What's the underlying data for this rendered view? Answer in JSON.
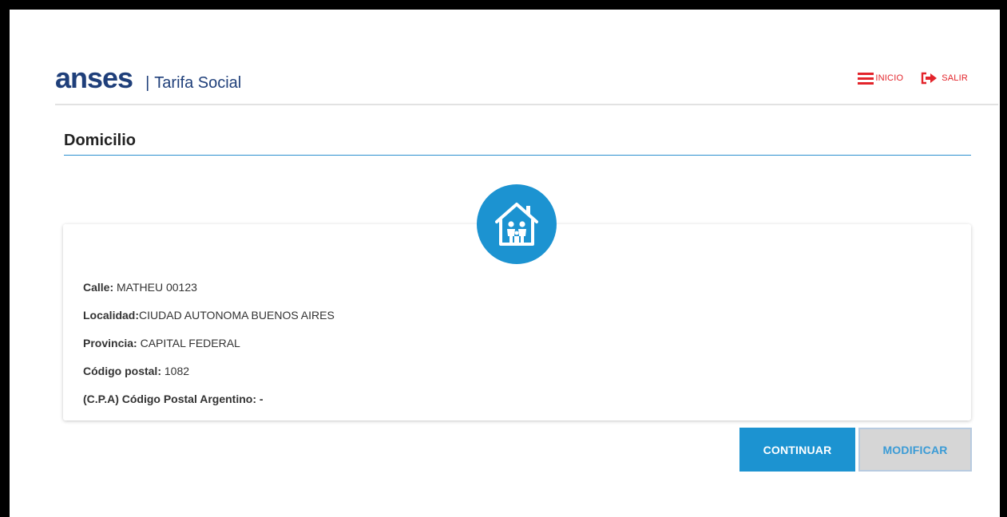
{
  "header": {
    "logo_text": "anses",
    "separator": "|",
    "app_name": "Tarifa Social",
    "nav": {
      "home_label": "INICIO",
      "logout_label": "SALIR"
    }
  },
  "section": {
    "title": "Domicilio"
  },
  "address": {
    "street_label": "Calle:",
    "street_value": " MATHEU 00123",
    "locality_label": "Localidad:",
    "locality_value": "CIUDAD AUTONOMA BUENOS AIRES",
    "province_label": "Provincia:",
    "province_value": " CAPITAL FEDERAL",
    "postal_label": "Código postal:",
    "postal_value": " 1082",
    "cpa_label": "(C.P.A) Código Postal Argentino:",
    "cpa_value": " -"
  },
  "actions": {
    "continue_label": "CONTINUAR",
    "modify_label": "MODIFICAR"
  },
  "colors": {
    "brand_blue": "#1f3f7a",
    "accent_blue": "#1c93d1",
    "nav_red": "#e3242b"
  }
}
